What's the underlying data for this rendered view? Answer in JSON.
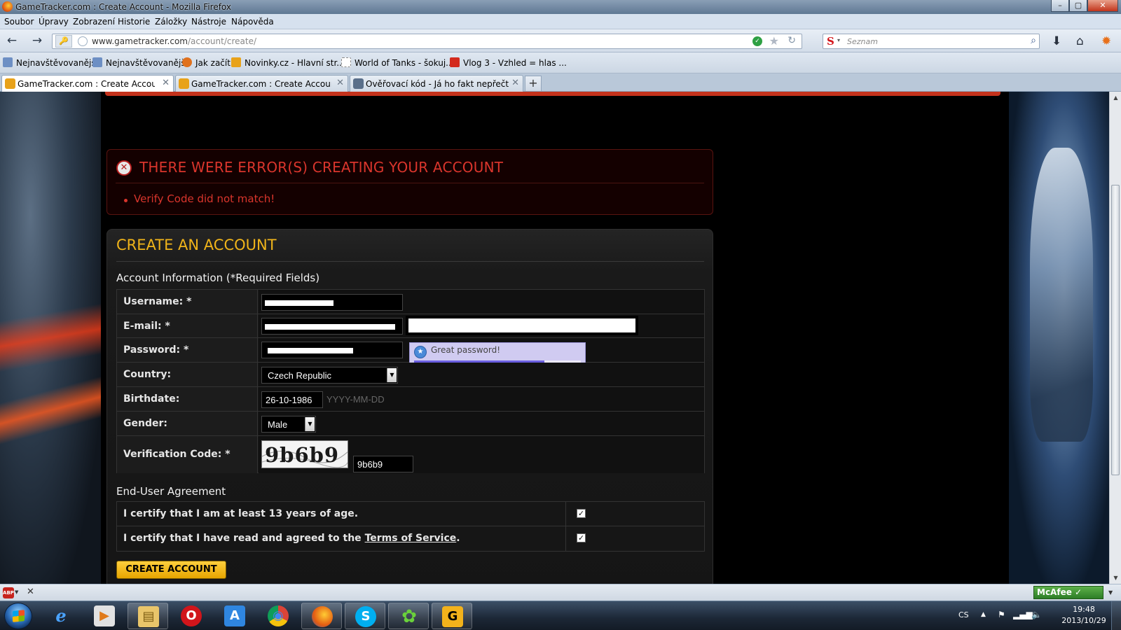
{
  "window": {
    "title": "GameTracker.com : Create Account - Mozilla Firefox",
    "buttons": {
      "minimize": "–",
      "maximize": "▢",
      "close": "✕"
    }
  },
  "menu": [
    "Soubor",
    "Úpravy",
    "Zobrazení",
    "Historie",
    "Záložky",
    "Nástroje",
    "Nápověda"
  ],
  "nav": {
    "url_host": "www.gametracker.com",
    "url_path": "/account/create/",
    "search_placeholder": "Seznam",
    "search_engine_letter": "S"
  },
  "bookmarks": [
    "Nejnavštěvovanější",
    "Nejnavštěvovanější",
    "Jak začít",
    "Novinky.cz - Hlavní str...",
    "World of Tanks - šokuj...",
    "Vlog 3 - Vzhled = hlas ..."
  ],
  "tabs": [
    {
      "label": "GameTracker.com : Create Account",
      "active": true
    },
    {
      "label": "GameTracker.com : Create Account",
      "active": false
    },
    {
      "label": "Ověřovací kód - Já ho fakt nepřečtu! :-/",
      "active": false
    }
  ],
  "newtab_label": "+",
  "error": {
    "title": "THERE WERE ERROR(S) CREATING YOUR ACCOUNT",
    "icon_glyph": "✕",
    "messages": [
      "Verify Code did not match!"
    ]
  },
  "form": {
    "title": "CREATE AN ACCOUNT",
    "section_title": "Account Information (*Required Fields)",
    "labels": {
      "username": "Username: *",
      "email": "E-mail: *",
      "password": "Password: *",
      "country": "Country:",
      "birthdate": "Birthdate:",
      "gender": "Gender:",
      "verification": "Verification Code: *"
    },
    "values": {
      "country": "Czech Republic",
      "birthdate": "26-10-1986",
      "gender": "Male",
      "verification": "9b6b9"
    },
    "birthdate_hint": "YYYY-MM-DD",
    "password_tip": "Great password!",
    "password_strength": 0.78,
    "captcha_text": "9b6b9"
  },
  "agreement": {
    "title": "End-User Agreement",
    "age_label": "I certify that I am at least 13 years of age.",
    "tos_prefix": "I certify that I have read and agreed to the ",
    "tos_link": "Terms of Service",
    "tos_suffix": ".",
    "age_checked": true,
    "tos_checked": true,
    "check_glyph": "✓"
  },
  "submit_label": "CREATE ACCOUNT",
  "addonbar": {
    "abp": "ABP",
    "close": "✕",
    "mcafee": "McAfee"
  },
  "taskbar": {
    "lang": "CS",
    "time": "19:48",
    "date": "2013/10/29",
    "items": [
      "e",
      "▶",
      "▤",
      "O",
      "A",
      "◉",
      "●",
      "S",
      "✿",
      "G"
    ]
  },
  "colors": {
    "accent_gold": "#f0b41a",
    "error_red": "#d9352c",
    "button_yellow": "#ffcf3d",
    "strength_purple": "#6b5fe0"
  }
}
